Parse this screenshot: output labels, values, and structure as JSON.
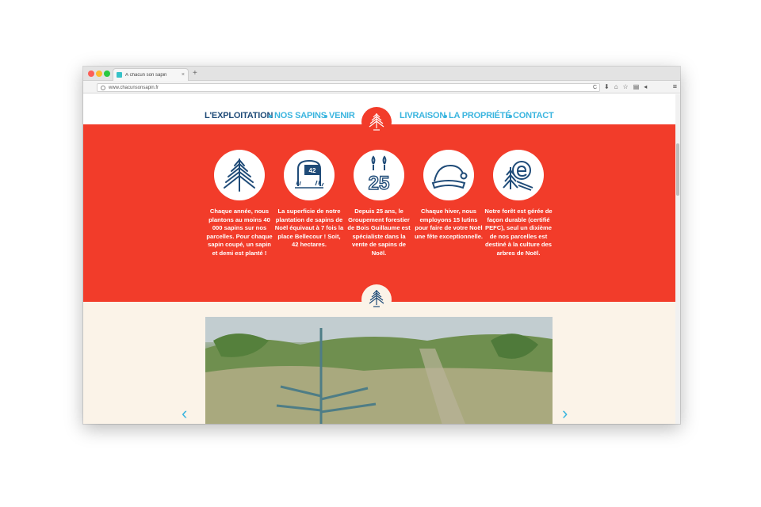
{
  "browser": {
    "tab_title": "À chacun son sapin",
    "tab_close": "×",
    "new_tab": "+",
    "url": "www.chacunsonsapin.fr",
    "reload": "C",
    "menu": "≡"
  },
  "nav": {
    "items": [
      {
        "label": "L'EXPLOITATION",
        "active": true
      },
      {
        "label": "NOS SAPINS",
        "active": false
      },
      {
        "label": "VENIR",
        "active": false
      },
      {
        "label": "LIVRAISON",
        "active": false
      },
      {
        "label": "LA PROPRIÉTÉ",
        "active": false
      },
      {
        "label": "CONTACT",
        "active": false
      }
    ]
  },
  "features": [
    {
      "icon": "fir-tree-icon",
      "text": "Chaque année, nous plantons au moins 40 000 sapins sur nos parcelles. Pour chaque sapin coupé, un sapin et demi est planté !"
    },
    {
      "icon": "plaque-42-icon",
      "badge": "42",
      "text": "La superficie de notre plantation de sapins de Noël équivaut à 7 fois la place Bellecour ! Soit, 42 hectares."
    },
    {
      "icon": "candles-25-icon",
      "badge": "25",
      "text": "Depuis 25 ans, le Groupement forestier de Bois Guillaume est spécialiste dans la vente de sapins de Noël."
    },
    {
      "icon": "santa-hat-icon",
      "text": "Chaque hiver, nous employons 15 lutins pour faire de votre Noël une fête exceptionnelle."
    },
    {
      "icon": "pefc-leaf-icon",
      "text": "Notre forêt est gérée de façon durable (certifié PEFC), seul un dixième de nos parcelles est destiné à la culture des arbres de Noël."
    }
  ],
  "carousel": {
    "prev": "‹",
    "next": "›"
  },
  "colors": {
    "red": "#f23c2a",
    "navy": "#1f4b78",
    "cyan": "#3bb5df",
    "cream": "#fbf3e8"
  }
}
